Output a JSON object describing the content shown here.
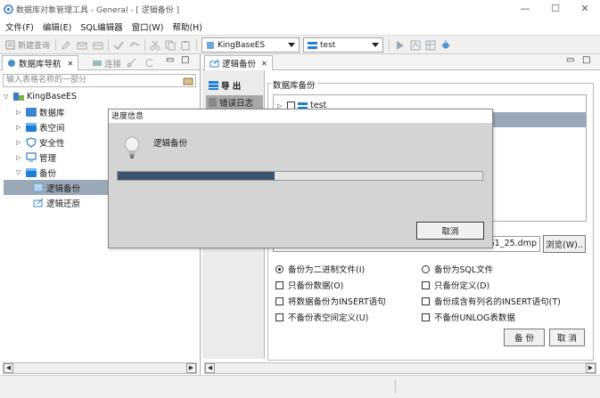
{
  "window": {
    "title": "数据库对象管理工具 - General - [ 逻辑备份 ]",
    "minimize": "—",
    "maximize": "☐",
    "close": "✕"
  },
  "menu": {
    "file": "文件(F)",
    "edit": "编辑(E)",
    "sql_editor": "SQL编辑器",
    "window": "窗口(W)",
    "help": "帮助(H)"
  },
  "toolbar": {
    "new_query": "新建查询",
    "connection_combo": "KingBaseES",
    "database_combo": "test"
  },
  "navigator": {
    "tab_label": "数据库导航",
    "connect_label": "连接",
    "filter_placeholder": "输入表格名称的一部分",
    "root": "KingBaseES",
    "items": [
      "数据库",
      "表空间",
      "安全性",
      "管理",
      "备份"
    ],
    "backup_children": [
      "逻辑备份",
      "逻辑还原"
    ]
  },
  "editor": {
    "tab_label": "逻辑备份",
    "side_tabs": [
      "导 出",
      "错误日志"
    ],
    "group_title": "数据库备份",
    "tree_item": "test",
    "file_path": "_51_25.dmp",
    "browse_button": "浏览(W)..",
    "options": {
      "radio_binary": "备份为二进制文件(I)",
      "radio_sql": "备份为SQL文件",
      "only_data": "只备份数据(O)",
      "only_definition": "只备份定义(D)",
      "as_insert": "将数据备份为INSERT语句",
      "column_insert": "备份成含有列名的INSERT语句(T)",
      "no_tablespace": "不备份表空间定义(U)",
      "no_unlog": "不备份UNLOG表数据"
    },
    "backup_button": "备 份",
    "cancel_button": "取 消"
  },
  "progress_dialog": {
    "title": "进度信息",
    "message": "逻辑备份",
    "progress_fraction": 0.43,
    "cancel_button": "取消"
  },
  "icons": {
    "app": "app-icon",
    "bulb": "lightbulb-icon"
  },
  "colors": {
    "selection": "#9aa9b8",
    "progress_fill": "#3c556e",
    "accent_blue": "#1f7fd4"
  }
}
